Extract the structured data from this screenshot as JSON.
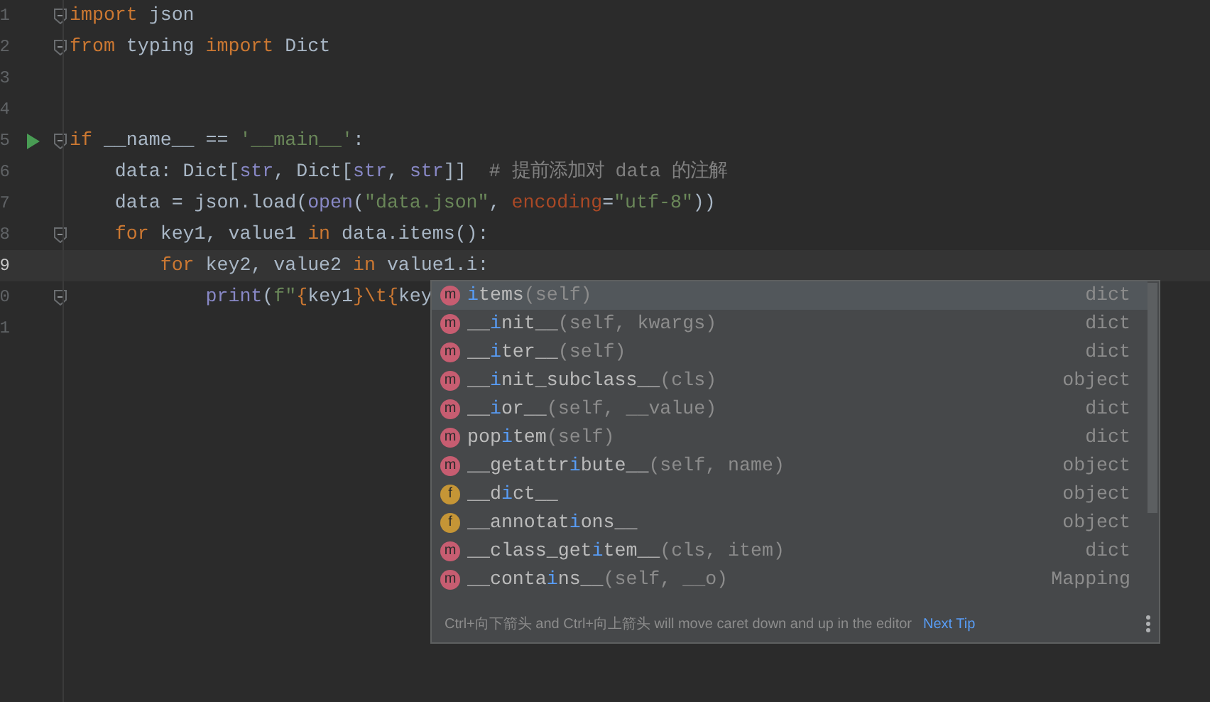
{
  "code_lines": [
    {
      "number": "1",
      "fold": true,
      "run": false,
      "current": false,
      "tokens": [
        {
          "kind": "keyword",
          "text": "import"
        },
        {
          "kind": "plain",
          "text": " json"
        }
      ]
    },
    {
      "number": "2",
      "fold": true,
      "run": false,
      "current": false,
      "tokens": [
        {
          "kind": "keyword",
          "text": "from"
        },
        {
          "kind": "plain",
          "text": " typing "
        },
        {
          "kind": "keyword",
          "text": "import"
        },
        {
          "kind": "plain",
          "text": " Dict"
        }
      ]
    },
    {
      "number": "3",
      "fold": false,
      "run": false,
      "current": false
    },
    {
      "number": "4",
      "fold": false,
      "run": false,
      "current": false
    },
    {
      "number": "5",
      "fold": true,
      "run": true,
      "current": false,
      "tokens": [
        {
          "kind": "keyword",
          "text": "if"
        },
        {
          "kind": "plain",
          "text": " __name__ == "
        },
        {
          "kind": "string",
          "text": "'__main__'"
        },
        {
          "kind": "plain",
          "text": ":"
        }
      ]
    },
    {
      "number": "6",
      "fold": false,
      "run": false,
      "current": false,
      "tokens": [
        {
          "kind": "plain",
          "text": "    data: Dict["
        },
        {
          "kind": "builtin",
          "text": "str"
        },
        {
          "kind": "plain",
          "text": ", Dict["
        },
        {
          "kind": "builtin",
          "text": "str"
        },
        {
          "kind": "plain",
          "text": ", "
        },
        {
          "kind": "builtin",
          "text": "str"
        },
        {
          "kind": "plain",
          "text": "]]  "
        },
        {
          "kind": "comment",
          "text": "# 提前添加对 data 的注解"
        }
      ]
    },
    {
      "number": "7",
      "fold": false,
      "run": false,
      "current": false,
      "tokens": [
        {
          "kind": "plain",
          "text": "    data = json.load("
        },
        {
          "kind": "builtin",
          "text": "open"
        },
        {
          "kind": "plain",
          "text": "("
        },
        {
          "kind": "string",
          "text": "\"data.json\""
        },
        {
          "kind": "plain",
          "text": ", "
        },
        {
          "kind": "named_arg",
          "text": "encoding"
        },
        {
          "kind": "plain",
          "text": "="
        },
        {
          "kind": "string",
          "text": "\"utf-8\""
        },
        {
          "kind": "plain",
          "text": "))"
        }
      ]
    },
    {
      "number": "8",
      "fold": true,
      "run": false,
      "current": false,
      "tokens": [
        {
          "kind": "keyword",
          "text": "    for"
        },
        {
          "kind": "plain",
          "text": " key1, value1 "
        },
        {
          "kind": "keyword",
          "text": "in"
        },
        {
          "kind": "plain",
          "text": " data.items():"
        }
      ]
    },
    {
      "number": "9",
      "fold": false,
      "run": false,
      "current": true,
      "tokens": [
        {
          "kind": "keyword",
          "text": "        for"
        },
        {
          "kind": "plain",
          "text": " key2, value2 "
        },
        {
          "kind": "keyword",
          "text": "in"
        },
        {
          "kind": "plain",
          "text": " value1.i:"
        }
      ]
    },
    {
      "number": "0",
      "fold": true,
      "run": false,
      "current": false,
      "tokens": [
        {
          "kind": "builtin",
          "text": "            print"
        },
        {
          "kind": "plain",
          "text": "("
        },
        {
          "kind": "string",
          "text": "f\""
        },
        {
          "kind": "keyword",
          "text": "{"
        },
        {
          "kind": "plain",
          "text": "key1"
        },
        {
          "kind": "keyword",
          "text": "}\\t{"
        },
        {
          "kind": "plain",
          "text": "key"
        }
      ]
    },
    {
      "number": "1",
      "fold": false,
      "run": false,
      "current": false
    }
  ],
  "completion_popup": {
    "items": [
      {
        "icon": "m",
        "kind": "method",
        "match": "i",
        "after": "tems",
        "params": "(self)",
        "type": "dict",
        "selected": true
      },
      {
        "icon": "m",
        "kind": "method",
        "before": "__",
        "match": "i",
        "after": "nit__",
        "params": "(self, kwargs)",
        "type": "dict",
        "selected": false
      },
      {
        "icon": "m",
        "kind": "method",
        "before": "__",
        "match": "i",
        "after": "ter__",
        "params": "(self)",
        "type": "dict",
        "selected": false
      },
      {
        "icon": "m",
        "kind": "method",
        "before": "__",
        "match": "i",
        "after": "nit_subclass__",
        "params": "(cls)",
        "type": "object",
        "selected": false
      },
      {
        "icon": "m",
        "kind": "method",
        "before": "__",
        "match": "i",
        "after": "or__",
        "params": "(self, __value)",
        "type": "dict",
        "selected": false
      },
      {
        "icon": "m",
        "kind": "method",
        "before": "pop",
        "match": "i",
        "after": "tem",
        "params": "(self)",
        "type": "dict",
        "selected": false
      },
      {
        "icon": "m",
        "kind": "method",
        "before": "__getattr",
        "match": "i",
        "after": "bute__",
        "params": "(self, name)",
        "type": "object",
        "selected": false
      },
      {
        "icon": "f",
        "kind": "field",
        "before": "__d",
        "match": "i",
        "after": "ct__",
        "type": "object",
        "selected": false
      },
      {
        "icon": "f",
        "kind": "field",
        "before": "__annotat",
        "match": "i",
        "after": "ons__",
        "type": "object",
        "selected": false
      },
      {
        "icon": "m",
        "kind": "method",
        "before": "__class_get",
        "match": "i",
        "after": "tem__",
        "params": "(cls, item)",
        "type": "dict",
        "selected": false
      },
      {
        "icon": "m",
        "kind": "method",
        "before": "__conta",
        "match": "i",
        "after": "ns__",
        "params": "(self, __o)",
        "type": "Mapping",
        "selected": false
      }
    ],
    "tip": "Ctrl+向下箭头 and Ctrl+向上箭头 will move caret down and up in the editor",
    "next_tip": "Next Tip"
  }
}
